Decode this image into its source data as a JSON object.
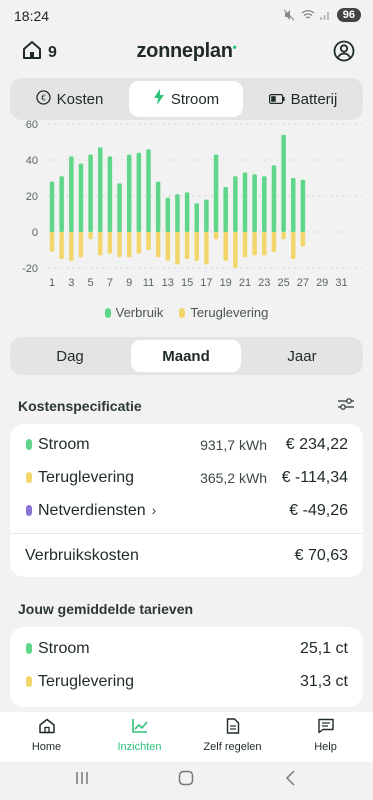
{
  "status_bar": {
    "time": "18:24",
    "battery": "96",
    "icons": [
      "mute-icon",
      "wifi-icon",
      "signal-icon"
    ]
  },
  "header": {
    "home_count": "9",
    "logo_text": "zonneplan",
    "logo_dot": "•"
  },
  "top_tabs": [
    {
      "label": "Kosten",
      "icon": "euro-icon",
      "active": false
    },
    {
      "label": "Stroom",
      "icon": "lightning-icon",
      "active": true
    },
    {
      "label": "Batterij",
      "icon": "battery-icon",
      "active": false
    }
  ],
  "chart_data": {
    "type": "bar",
    "categories": [
      "1",
      "2",
      "3",
      "4",
      "5",
      "6",
      "7",
      "8",
      "9",
      "10",
      "11",
      "12",
      "13",
      "14",
      "15",
      "16",
      "17",
      "18",
      "19",
      "20",
      "21",
      "22",
      "23",
      "24",
      "25",
      "26",
      "27",
      "28",
      "29",
      "30",
      "31"
    ],
    "x_tick_labels": [
      "1",
      "3",
      "5",
      "7",
      "9",
      "11",
      "13",
      "15",
      "17",
      "19",
      "21",
      "23",
      "25",
      "27",
      "29",
      "31"
    ],
    "y_tick_labels": [
      "60",
      "40",
      "20",
      "0",
      "-20"
    ],
    "ylim": [
      -20,
      60
    ],
    "grid": true,
    "series": [
      {
        "name": "Verbruik",
        "color": "#5fd68a",
        "values": [
          28,
          31,
          42,
          38,
          43,
          47,
          42,
          27,
          43,
          44,
          46,
          28,
          19,
          21,
          22,
          16,
          18,
          43,
          25,
          31,
          33,
          32,
          31,
          37,
          54,
          30,
          29,
          0,
          0,
          0,
          0
        ]
      },
      {
        "name": "Teruglevering",
        "color": "#f3d66b",
        "values": [
          -11,
          -15,
          -16,
          -14,
          -4,
          -13,
          -12,
          -14,
          -14,
          -12,
          -10,
          -14,
          -16,
          -18,
          -15,
          -16,
          -18,
          -4,
          -16,
          -20,
          -14,
          -13,
          -13,
          -11,
          -4,
          -15,
          -8,
          0,
          0,
          0,
          0
        ]
      }
    ]
  },
  "legend": [
    {
      "label": "Verbruik",
      "color": "#5fd68a"
    },
    {
      "label": "Teruglevering",
      "color": "#f3d66b"
    }
  ],
  "period_tabs": [
    {
      "label": "Dag",
      "active": false
    },
    {
      "label": "Maand",
      "active": true
    },
    {
      "label": "Jaar",
      "active": false
    }
  ],
  "kosten": {
    "title": "Kostenspecificatie",
    "rows": [
      {
        "label": "Stroom",
        "kwh": "931,7 kWh",
        "amount": "€ 234,22",
        "color": "#5fd68a"
      },
      {
        "label": "Teruglevering",
        "kwh": "365,2 kWh",
        "amount": "€ -114,34",
        "color": "#f3d66b"
      },
      {
        "label": "Netverdiensten",
        "chevron": "›",
        "amount": "€ -49,26",
        "color": "#8b73d6"
      }
    ],
    "total_label": "Verbruikskosten",
    "total_amount": "€ 70,63"
  },
  "tarieven": {
    "title": "Jouw gemiddelde tarieven",
    "rows": [
      {
        "label": "Stroom",
        "value": "25,1 ct",
        "color": "#5fd68a"
      },
      {
        "label": "Teruglevering",
        "value": "31,3 ct",
        "color": "#f3d66b"
      }
    ]
  },
  "bottom_nav": [
    {
      "label": "Home",
      "icon": "home-icon",
      "active": false
    },
    {
      "label": "Inzichten",
      "icon": "chart-icon",
      "active": true
    },
    {
      "label": "Zelf regelen",
      "icon": "document-icon",
      "active": false
    },
    {
      "label": "Help",
      "icon": "chat-icon",
      "active": false
    }
  ]
}
